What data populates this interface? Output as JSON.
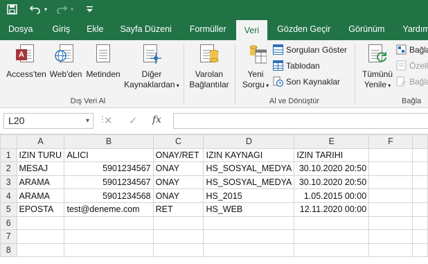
{
  "quick_access": {
    "save_icon": "save-icon",
    "undo_icon": "undo-icon",
    "redo_icon": "redo-icon",
    "customize_icon": "customize-qat-icon"
  },
  "tabs": [
    {
      "label": "Dosya"
    },
    {
      "label": "Giriş"
    },
    {
      "label": "Ekle"
    },
    {
      "label": "Sayfa Düzeni"
    },
    {
      "label": "Formüller"
    },
    {
      "label": "Veri"
    },
    {
      "label": "Gözden Geçir"
    },
    {
      "label": "Görünüm"
    },
    {
      "label": "Yardım"
    }
  ],
  "active_tab": "Veri",
  "ribbon": {
    "external_data": {
      "group_label": "Dış Veri Al",
      "access": "Access'ten",
      "web": "Web'den",
      "text": "Metinden",
      "other_line1": "Diğer",
      "other_line2": "Kaynaklardan",
      "existing_line1": "Varolan",
      "existing_line2": "Bağlantılar"
    },
    "get_transform": {
      "group_label": "Al ve Dönüştür",
      "new_query_line1": "Yeni",
      "new_query_line2": "Sorgu",
      "show_queries": "Sorguları Göster",
      "from_table": "Tablodan",
      "recent_sources": "Son Kaynaklar"
    },
    "connections": {
      "group_label": "Bağla",
      "refresh_line1": "Tümünü",
      "refresh_line2": "Yenile",
      "connections": "Bağla",
      "properties": "Özell",
      "edit_links": "Bağla"
    }
  },
  "formula_bar": {
    "name_box": "L20",
    "cancel": "✕",
    "enter": "✓",
    "fx": "fx",
    "formula": ""
  },
  "sheet": {
    "columns": [
      "A",
      "B",
      "C",
      "D",
      "E",
      "F"
    ],
    "rows": [
      {
        "n": "1",
        "cells": [
          "IZIN TURU",
          "ALICI",
          "ONAY/RET",
          "IZIN KAYNAGI",
          "IZIN TARIHI",
          ""
        ]
      },
      {
        "n": "2",
        "cells": [
          "MESAJ",
          "5901234567",
          "ONAY",
          "HS_SOSYAL_MEDYA",
          "30.10.2020 20:50",
          ""
        ]
      },
      {
        "n": "3",
        "cells": [
          "ARAMA",
          "5901234567",
          "ONAY",
          "HS_SOSYAL_MEDYA",
          "30.10.2020 20:50",
          ""
        ]
      },
      {
        "n": "4",
        "cells": [
          "ARAMA",
          "5901234568",
          "ONAY",
          "HS_2015",
          "1.05.2015 00:00",
          ""
        ]
      },
      {
        "n": "5",
        "cells": [
          "EPOSTA",
          "test@deneme.com",
          "RET",
          "HS_WEB",
          "12.11.2020 00:00",
          ""
        ]
      },
      {
        "n": "6",
        "cells": [
          "",
          "",
          "",
          "",
          "",
          ""
        ]
      },
      {
        "n": "7",
        "cells": [
          "",
          "",
          "",
          "",
          "",
          ""
        ]
      },
      {
        "n": "8",
        "cells": [
          "",
          "",
          "",
          "",
          "",
          ""
        ]
      }
    ]
  },
  "colors": {
    "excel_green": "#217346",
    "ribbon_bg": "#f3f3f3"
  }
}
